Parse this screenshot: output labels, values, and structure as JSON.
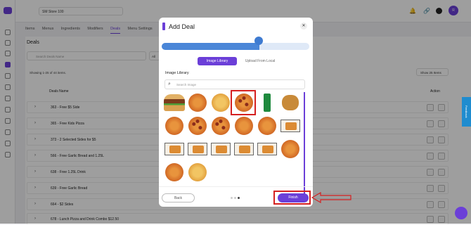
{
  "topbar": {
    "store": "SM Store 100",
    "avatar": "R"
  },
  "tabs": [
    {
      "label": "Items"
    },
    {
      "label": "Menus"
    },
    {
      "label": "Ingredients"
    },
    {
      "label": "Modifiers"
    },
    {
      "label": "Deals",
      "active": true
    },
    {
      "label": "Menu Settings"
    }
  ],
  "deals": {
    "title": "Deals",
    "search_placeholder": "Search Deals Name",
    "filter_all": "All",
    "showing": "Showing 1-25 of 44 items.",
    "page_size": "Show 25 Items",
    "col_name": "Deals Name",
    "col_action": "Action",
    "rows": [
      {
        "name": "363 - Free $5 Side"
      },
      {
        "name": "365 - Free Kids Pizza"
      },
      {
        "name": "373 - 2 Selected Sides for $5"
      },
      {
        "name": "566 - Free Garlic Bread and 1.25L"
      },
      {
        "name": "638 - Free 1.25L Drink"
      },
      {
        "name": "639 - Free Garlic Bread"
      },
      {
        "name": "664 - $2 Sides"
      },
      {
        "name": "678 - Lunch Pizza and Drink Combo $12.50"
      }
    ]
  },
  "modal": {
    "title": "Add Deal",
    "progress_fraction": 0.66,
    "tab_library": "Image Library",
    "tab_upload": "Upload From Local",
    "section_label": "Image Library",
    "search_placeholder": "Search Image",
    "thumbnails": [
      {
        "kind": "burger"
      },
      {
        "kind": "pizza"
      },
      {
        "kind": "pizza-light"
      },
      {
        "kind": "pizza-dots",
        "selected": true
      },
      {
        "kind": "can"
      },
      {
        "kind": "wings"
      },
      {
        "kind": "pizza"
      },
      {
        "kind": "pizza-dots"
      },
      {
        "kind": "pizza-dots"
      },
      {
        "kind": "pizza"
      },
      {
        "kind": "pizza"
      },
      {
        "kind": "box"
      },
      {
        "kind": "box"
      },
      {
        "kind": "box"
      },
      {
        "kind": "box"
      },
      {
        "kind": "box"
      },
      {
        "kind": "box"
      },
      {
        "kind": "pizza"
      },
      {
        "kind": "pizza"
      },
      {
        "kind": "pizza-light"
      }
    ],
    "pager": {
      "pages": 3,
      "current": 3
    },
    "back": "Back",
    "finish": "Finish"
  },
  "feedback": "Feedback",
  "accent": "#6b3fd8",
  "highlight": "#d52020"
}
